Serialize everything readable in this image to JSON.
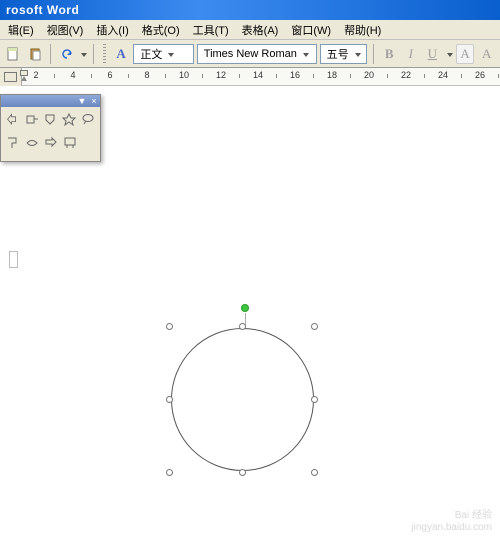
{
  "title": "rosoft Word",
  "menu": [
    "辑(E)",
    "视图(V)",
    "插入(I)",
    "格式(O)",
    "工具(T)",
    "表格(A)",
    "窗口(W)",
    "帮助(H)"
  ],
  "toolbar": {
    "styleA": "A",
    "style_combo": "正文",
    "font_combo": "Times New Roman",
    "size_combo": "五号",
    "bold": "B",
    "italic": "I",
    "underline": "U",
    "charA1": "A",
    "charA2": "A"
  },
  "ruler": {
    "numbers": [
      2,
      4,
      6,
      8,
      10,
      12,
      14,
      16,
      18,
      20,
      22,
      24,
      26
    ]
  },
  "floater": {
    "menu_arrow": "▼",
    "close": "×"
  },
  "watermark": {
    "line1": "Bai 经验",
    "line2": "jingyan.baidu.com"
  }
}
